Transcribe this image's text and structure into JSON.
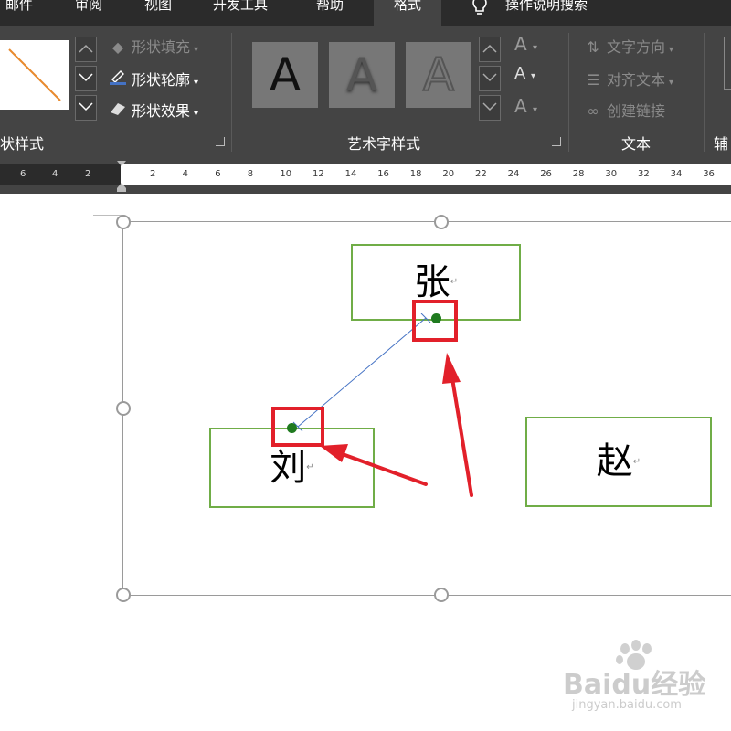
{
  "ribbon": {
    "tabs": [
      {
        "label": "邮件"
      },
      {
        "label": "审阅"
      },
      {
        "label": "视图"
      },
      {
        "label": "开发工具"
      },
      {
        "label": "帮助"
      },
      {
        "label": "格式",
        "active": true
      }
    ],
    "tell_me": "操作说明搜索",
    "shape_styles": {
      "group_label": "状样式",
      "fill": "形状填充",
      "outline": "形状轮廓",
      "effects": "形状效果"
    },
    "wordart": {
      "group_label": "艺术字样式",
      "preview_letter": "A"
    },
    "text": {
      "group_label": "文本",
      "direction": "文字方向",
      "align": "对齐文本",
      "link": "创建链接"
    },
    "aux_label": "辅"
  },
  "ruler": {
    "left_ticks": [
      "6",
      "4",
      "2"
    ],
    "right_ticks": [
      "2",
      "4",
      "6",
      "8",
      "10",
      "12",
      "14",
      "16",
      "18",
      "20",
      "22",
      "24",
      "26",
      "28",
      "30",
      "32",
      "34",
      "36"
    ]
  },
  "canvas": {
    "boxes": [
      {
        "id": "zhang",
        "text": "张"
      },
      {
        "id": "liu",
        "text": "刘"
      },
      {
        "id": "zhao",
        "text": "赵"
      }
    ],
    "paragraph_mark": "↵"
  },
  "watermark": {
    "brand": "Baidu经验",
    "url": "jingyan.baidu.com"
  },
  "colors": {
    "box_border": "#70ad47",
    "highlight": "#e2202a",
    "connector": "#4472c4",
    "endpoint": "#1f7a1f"
  }
}
